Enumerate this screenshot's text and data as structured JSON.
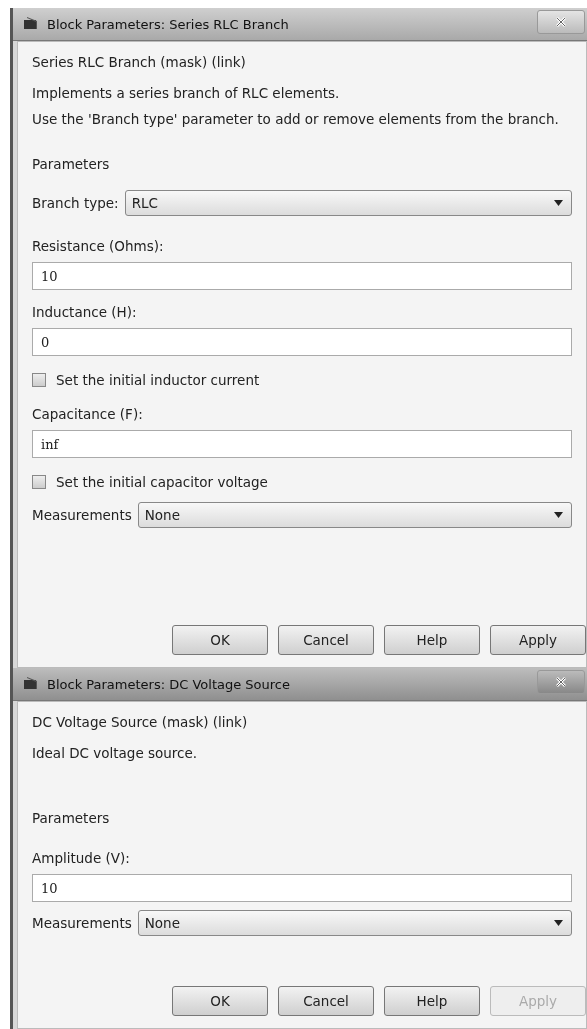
{
  "dialogs": [
    {
      "title": "Block Parameters: Series RLC Branch",
      "items": [
        {
          "kind": "heading",
          "text": "Series RLC Branch (mask) (link)"
        },
        {
          "kind": "text",
          "text": "Implements a series branch of RLC elements."
        },
        {
          "kind": "text",
          "text": "Use the 'Branch type' parameter to add or remove elements from the branch."
        },
        {
          "kind": "section",
          "text": "Parameters"
        },
        {
          "kind": "dropdown",
          "label": "Branch type:",
          "value": "RLC"
        },
        {
          "kind": "field",
          "label": "Resistance (Ohms):",
          "value": "10"
        },
        {
          "kind": "field",
          "label": "Inductance (H):",
          "value": "0"
        },
        {
          "kind": "checkbox",
          "label": "Set the initial inductor current",
          "checked": false
        },
        {
          "kind": "field",
          "label": "Capacitance (F):",
          "value": "inf"
        },
        {
          "kind": "checkbox",
          "label": "Set the initial capacitor voltage",
          "checked": false
        },
        {
          "kind": "dropdown",
          "label": "Measurements",
          "value": "None"
        }
      ],
      "buttons": [
        {
          "label": "OK",
          "disabled": false
        },
        {
          "label": "Cancel",
          "disabled": false
        },
        {
          "label": "Help",
          "disabled": false
        },
        {
          "label": "Apply",
          "disabled": false
        }
      ]
    },
    {
      "title": "Block Parameters: DC Voltage Source",
      "items": [
        {
          "kind": "heading",
          "text": "DC Voltage Source (mask) (link)"
        },
        {
          "kind": "text",
          "text": "Ideal DC voltage source."
        },
        {
          "kind": "section",
          "text": "Parameters"
        },
        {
          "kind": "field",
          "label": "Amplitude (V):",
          "value": "10"
        },
        {
          "kind": "dropdown",
          "label": "Measurements",
          "value": "None"
        }
      ],
      "buttons": [
        {
          "label": "OK",
          "disabled": false
        },
        {
          "label": "Cancel",
          "disabled": false
        },
        {
          "label": "Help",
          "disabled": false
        },
        {
          "label": "Apply",
          "disabled": true
        }
      ]
    }
  ]
}
